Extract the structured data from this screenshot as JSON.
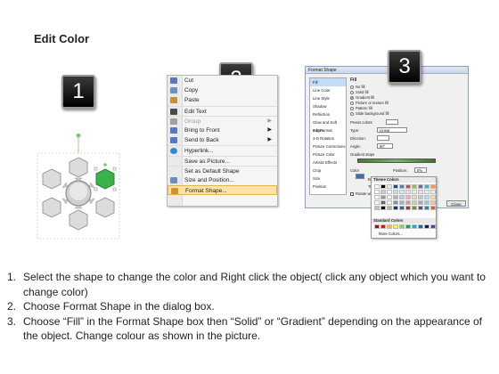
{
  "title": "Edit Color",
  "badges": [
    "1",
    "2",
    "3"
  ],
  "context_menu": {
    "items": [
      {
        "label": "Cut",
        "icon": "scissors-icon",
        "color": "#5a78b5"
      },
      {
        "label": "Copy",
        "icon": "copy-icon",
        "color": "#6f8fc8"
      },
      {
        "label": "Paste",
        "icon": "paste-icon",
        "color": "#c98f2d"
      },
      {
        "label": "Edit Text",
        "icon": "edit-text-icon",
        "color": "#4a4a4a"
      },
      {
        "label": "Group",
        "icon": "group-icon",
        "color": "#a0a0a0",
        "disabled": true,
        "submenu": true
      },
      {
        "label": "Bring to Front",
        "icon": "bring-front-icon",
        "color": "#4f7ac0",
        "submenu": true
      },
      {
        "label": "Send to Back",
        "icon": "send-back-icon",
        "color": "#4f7ac0",
        "submenu": true
      },
      {
        "label": "Hyperlink...",
        "icon": "globe-link-icon",
        "color": "#2d8ad6"
      },
      {
        "label": "Save as Picture...",
        "icon": "",
        "color": ""
      },
      {
        "label": "Set as Default Shape",
        "icon": "",
        "color": ""
      },
      {
        "label": "Size and Position...",
        "icon": "size-position-icon",
        "color": "#6b8ec0"
      },
      {
        "label": "Format Shape...",
        "icon": "format-shape-icon",
        "color": "#d6912d",
        "highlight": true
      }
    ]
  },
  "dialog": {
    "title": "Format Shape",
    "categories": [
      "Fill",
      "Line Color",
      "Line Style",
      "Shadow",
      "Reflection",
      "Glow and Soft Edges",
      "3-D Format",
      "3-D Rotation",
      "Picture Corrections",
      "Picture Color",
      "Artistic Effects",
      "Crop",
      "Size",
      "Position",
      "Text Box",
      "Alt Text"
    ],
    "section": "Fill",
    "fill_options": [
      "No fill",
      "Solid fill",
      "Gradient fill",
      "Picture or texture fill",
      "Pattern fill",
      "Slide background fill"
    ],
    "selected_fill": "Gradient fill",
    "labels": {
      "preset": "Preset colors:",
      "type": "Type:",
      "type_value": "Linear",
      "direction": "Direction:",
      "angle": "Angle:",
      "angle_value": "90°",
      "stops": "Gradient stops",
      "color": "Color",
      "position": "Position:",
      "position_value": "0%",
      "brightness": "Brightness:",
      "transparency": "Transparency:",
      "rotate": "Rotate with shape"
    },
    "close_label": "Close",
    "palette": {
      "theme_header": "Theme Colors",
      "standard_header": "Standard Colors",
      "more_label": "More Colors...",
      "theme_colors": [
        "#ffffff",
        "#000000",
        "#eeece1",
        "#1f497d",
        "#4f81bd",
        "#c0504d",
        "#9bbb59",
        "#8064a2",
        "#4bacc6",
        "#f79646"
      ],
      "standard_colors": [
        "#c00000",
        "#ff0000",
        "#ffc000",
        "#ffff00",
        "#92d050",
        "#00b050",
        "#00b0f0",
        "#0070c0",
        "#002060",
        "#7030a0"
      ]
    }
  },
  "instructions": [
    {
      "num": "1.",
      "text": "Select the shape to change the color and Right click the object( click any object which you want to change color)"
    },
    {
      "num": "2.",
      "text": "Choose Format Shape in the dialog box."
    },
    {
      "num": "3.",
      "text": "Choose “Fill” in the Format Shape box then “Solid” or “Gradient” depending on the appearance of the object. Change colour as shown in the picture."
    }
  ]
}
